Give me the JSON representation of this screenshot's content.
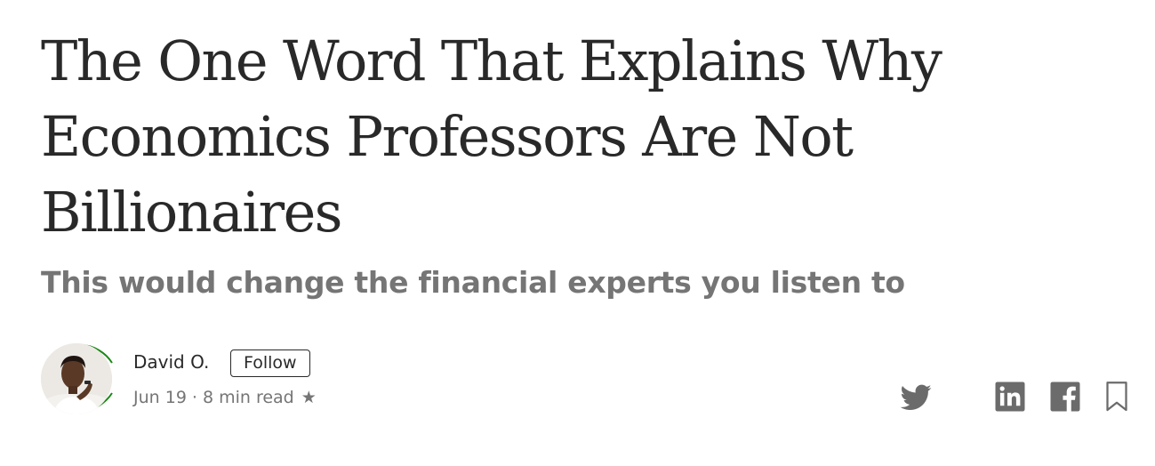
{
  "article": {
    "title": "The One Word That Explains Why Economics Professors Are Not Billionaires",
    "subtitle": "This would change the financial experts you listen to"
  },
  "author": {
    "name": "David O.",
    "follow_label": "Follow",
    "date": "Jun 19",
    "separator": "·",
    "read_time": "8 min read",
    "member_star": "★"
  },
  "share": {
    "icons": [
      "twitter-icon",
      "linkedin-icon",
      "facebook-icon",
      "bookmark-icon"
    ]
  },
  "colors": {
    "text": "#292929",
    "muted": "#757575",
    "icon": "#6b6b6b",
    "avatar_ring": "#1a8917"
  }
}
